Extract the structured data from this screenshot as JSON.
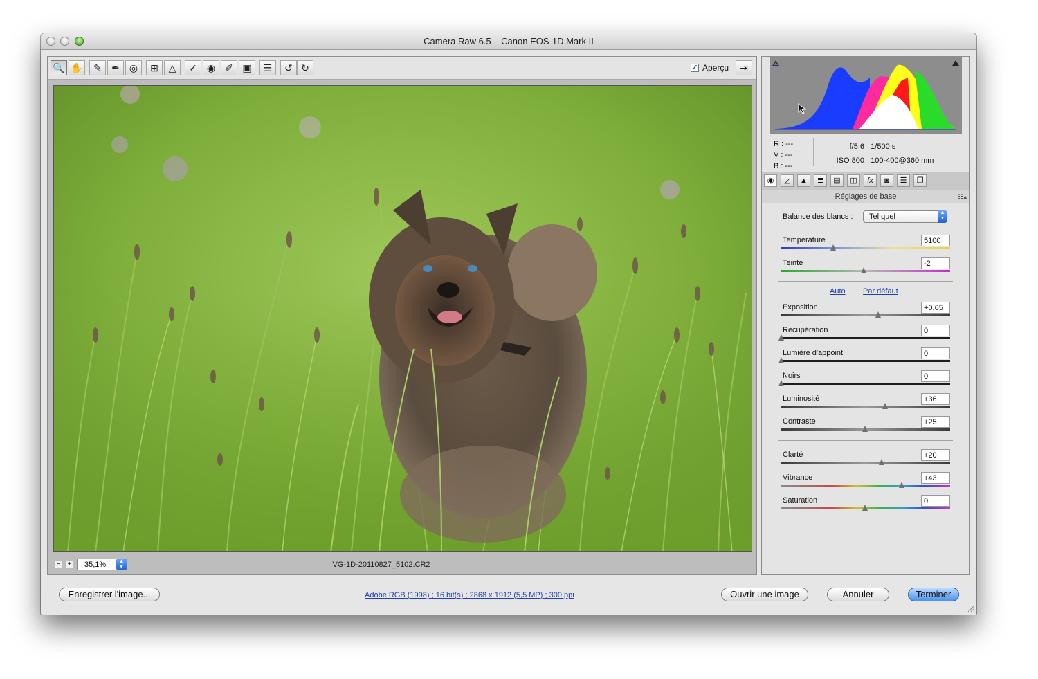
{
  "window": {
    "title": "Camera Raw 6.5  –  Canon EOS-1D Mark II"
  },
  "toolbar": {
    "tools": [
      "zoom-icon",
      "hand-icon",
      "white-balance-icon",
      "color-sampler-icon",
      "target-adjust-icon",
      "crop-icon",
      "straighten-icon",
      "spot-removal-icon",
      "red-eye-icon",
      "adjustment-brush-icon",
      "graduated-filter-icon",
      "preferences-icon",
      "rotate-left-icon",
      "rotate-right-icon"
    ],
    "preview_label": "Aperçu",
    "preview_checked": true
  },
  "preview": {
    "zoom_value": "35,1%",
    "filename": "VG-1D-20110827_5102.CR2"
  },
  "info": {
    "r_label": "R :",
    "r_value": "---",
    "v_label": "V :",
    "v_value": "---",
    "b_label": "B :",
    "b_value": "---",
    "aperture": "f/5,6",
    "shutter": "1/500 s",
    "iso": "ISO 800",
    "lens": "100-400@360 mm"
  },
  "panel": {
    "title": "Réglages de base",
    "tab_icons": [
      "basic-icon",
      "tone-curve-icon",
      "detail-icon",
      "hsl-icon",
      "split-toning-icon",
      "lens-corrections-icon",
      "effects-icon",
      "camera-calibration-icon",
      "presets-icon",
      "snapshots-icon"
    ],
    "wb_label": "Balance des blancs :",
    "wb_value": "Tel quel",
    "auto": "Auto",
    "default": "Par défaut",
    "sliders": [
      {
        "label": "Température",
        "value": "5100",
        "pos": 0.31,
        "track": "temp"
      },
      {
        "label": "Teinte",
        "value": "-2",
        "pos": 0.49,
        "track": "tint"
      },
      {
        "label": "Exposition",
        "value": "+0,65",
        "pos": 0.58,
        "track": "gray"
      },
      {
        "label": "Récupération",
        "value": "0",
        "pos": 0.0,
        "track": "black"
      },
      {
        "label": "Lumière d'appoint",
        "value": "0",
        "pos": 0.0,
        "track": "black"
      },
      {
        "label": "Noirs",
        "value": "0",
        "pos": 0.0,
        "track": "black"
      },
      {
        "label": "Luminosité",
        "value": "+36",
        "pos": 0.62,
        "track": "gray"
      },
      {
        "label": "Contraste",
        "value": "+25",
        "pos": 0.5,
        "track": "gray"
      },
      {
        "label": "Clarté",
        "value": "+20",
        "pos": 0.6,
        "track": "gray"
      },
      {
        "label": "Vibrance",
        "value": "+43",
        "pos": 0.72,
        "track": "rainbow"
      },
      {
        "label": "Saturation",
        "value": "0",
        "pos": 0.5,
        "track": "rainbow"
      }
    ]
  },
  "footer": {
    "save": "Enregistrer l'image...",
    "workflow": "Adobe RGB (1998) ; 16 bit(s) ; 2868 x 1912 (5,5 MP) ; 300 ppi",
    "open": "Ouvrir une image",
    "cancel": "Annuler",
    "done": "Terminer"
  }
}
